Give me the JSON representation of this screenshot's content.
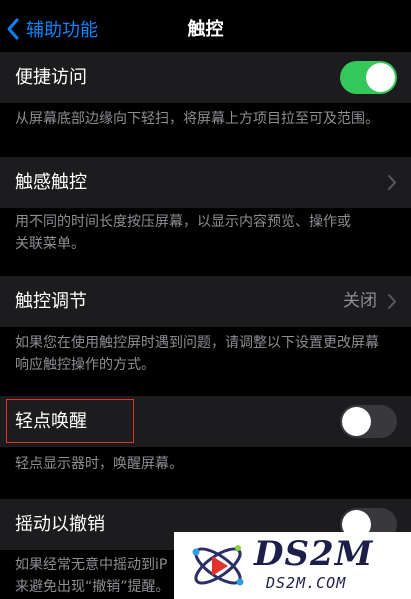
{
  "nav": {
    "back_label": "辅助功能",
    "title": "触控"
  },
  "rows": {
    "reachability": {
      "label": "便捷访问",
      "switch_on": true,
      "desc": "从屏幕底部边缘向下轻扫，将屏幕上方项目拉至可及范围。"
    },
    "haptic_touch": {
      "label": "触感触控",
      "desc_line1": "用不同的时间长度按压屏幕，以显示内容预览、操作或",
      "desc_line2": "关联菜单。"
    },
    "touch_accommodations": {
      "label": "触控调节",
      "value": "关闭",
      "desc_line1": "如果您在使用触控屏时遇到问题，请调整以下设置更改屏幕",
      "desc_line2": "响应触控操作的方式。"
    },
    "tap_to_wake": {
      "label": "轻点唤醒",
      "switch_on": false,
      "desc": "轻点显示器时，唤醒屏幕。"
    },
    "shake_to_undo": {
      "label": "摇动以撤销",
      "switch_on": false,
      "desc_line1": "如果经常无意中摇动到iP",
      "desc_line2": "来避免出现“撤销”提醒。"
    }
  },
  "watermark": {
    "brand": "DS2M",
    "domain": "DS2M.COM"
  },
  "colors": {
    "accent": "#0a84ff",
    "switch_on": "#34c759",
    "switch_off": "#39393d",
    "highlight_border": "#e0332b"
  }
}
